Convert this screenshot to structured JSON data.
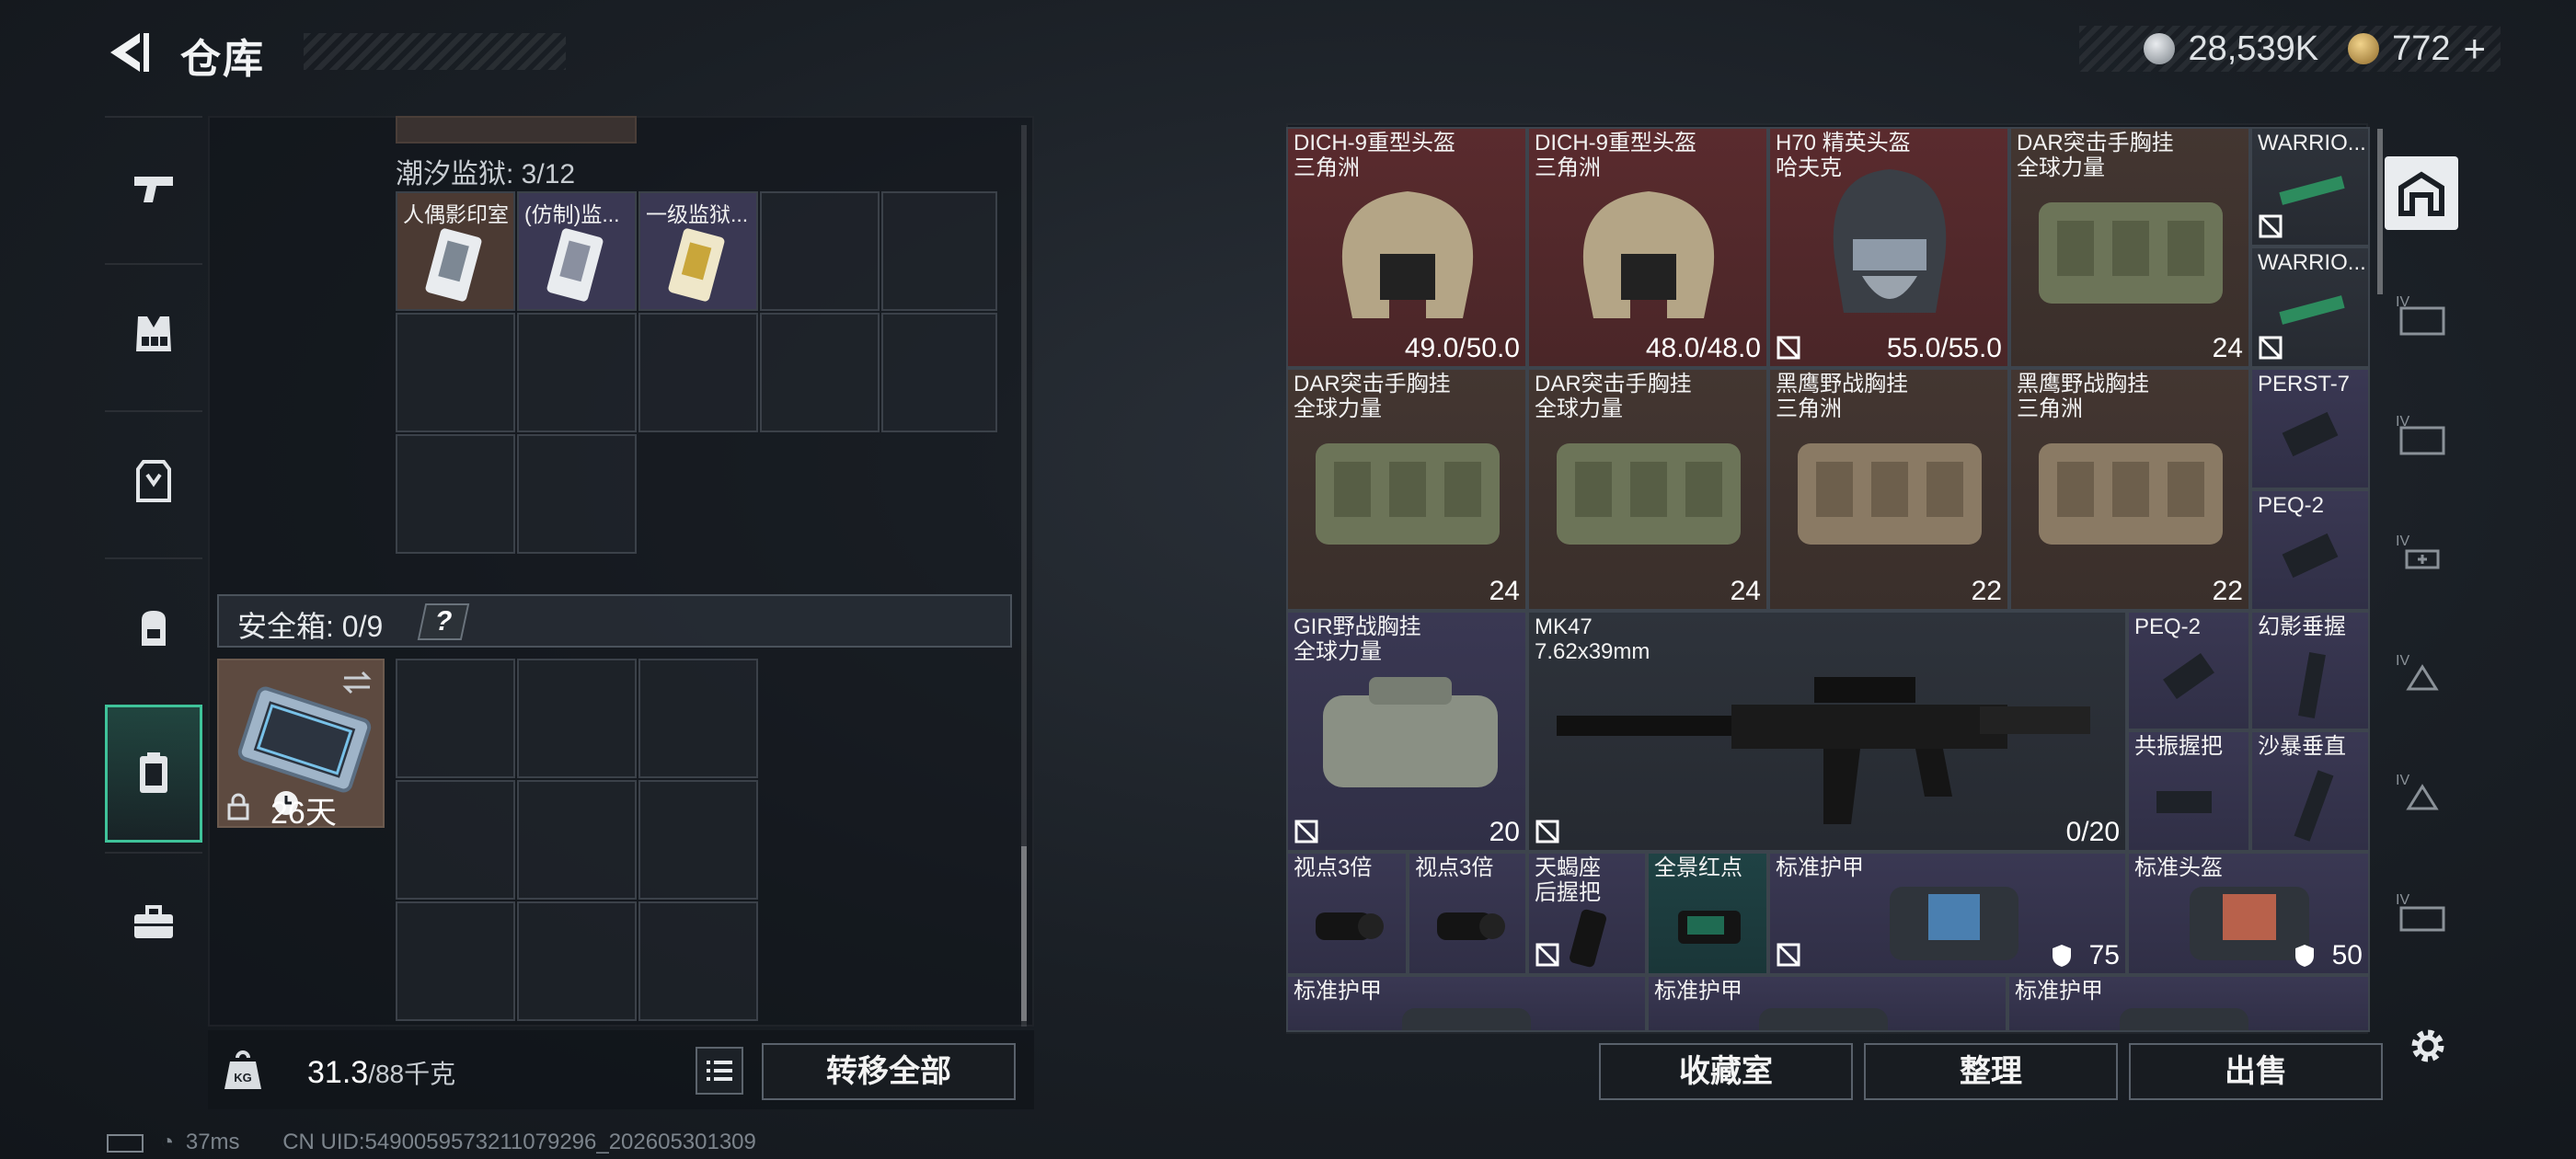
{
  "header": {
    "title": "仓库"
  },
  "currency": {
    "silver": "28,539K",
    "gold": "772",
    "gold_plus": "+"
  },
  "inventory": {
    "prison_label": "潮汐监狱: 3/12",
    "slots": [
      {
        "label": "人偶影印室"
      },
      {
        "label": "(仿制)监..."
      },
      {
        "label": "一级监狱..."
      }
    ],
    "safebox_label": "安全箱: 0/9",
    "safebox_help": "?",
    "safecase_days": "26天",
    "weight_value": "31.3",
    "weight_max": "/88千克",
    "transfer_all": "转移全部"
  },
  "stash": {
    "items": [
      {
        "name": "DICH-9重型头盔",
        "sub": "三角洲",
        "value": "49.0/50.0"
      },
      {
        "name": "DICH-9重型头盔",
        "sub": "三角洲",
        "value": "48.0/48.0"
      },
      {
        "name": "H70 精英头盔",
        "sub": "哈夫克",
        "value": "55.0/55.0"
      },
      {
        "name": "DAR突击手胸挂",
        "sub": "全球力量",
        "value": "24"
      },
      {
        "name": "WARRIO...",
        "sub": "",
        "value": ""
      },
      {
        "name": "WARRIO...",
        "sub": "",
        "value": ""
      },
      {
        "name": "DAR突击手胸挂",
        "sub": "全球力量",
        "value": "24"
      },
      {
        "name": "DAR突击手胸挂",
        "sub": "全球力量",
        "value": "24"
      },
      {
        "name": "黑鹰野战胸挂",
        "sub": "三角洲",
        "value": "22"
      },
      {
        "name": "黑鹰野战胸挂",
        "sub": "三角洲",
        "value": "22"
      },
      {
        "name": "PERST-7",
        "sub": "",
        "value": ""
      },
      {
        "name": "PEQ-2",
        "sub": "",
        "value": ""
      },
      {
        "name": "GIR野战胸挂",
        "sub": "全球力量",
        "value": "20"
      },
      {
        "name": "MK47",
        "sub": "7.62x39mm",
        "value": "0/20"
      },
      {
        "name": "PEQ-2",
        "sub": "",
        "value": ""
      },
      {
        "name": "幻影垂握",
        "sub": "",
        "value": ""
      },
      {
        "name": "共振握把",
        "sub": "",
        "value": ""
      },
      {
        "name": "沙暴垂直",
        "sub": "",
        "value": ""
      },
      {
        "name": "视点3倍",
        "sub": "",
        "value": ""
      },
      {
        "name": "视点3倍",
        "sub": "",
        "value": ""
      },
      {
        "name": "天蝎座",
        "sub": "后握把",
        "value": ""
      },
      {
        "name": "全景红点",
        "sub": "",
        "value": ""
      },
      {
        "name": "标准护甲",
        "sub": "",
        "value": "75"
      },
      {
        "name": "标准头盔",
        "sub": "",
        "value": "50"
      },
      {
        "name": "标准护甲",
        "sub": "",
        "value": ""
      },
      {
        "name": "标准护甲",
        "sub": "",
        "value": ""
      },
      {
        "name": "标准护甲",
        "sub": "",
        "value": ""
      }
    ],
    "buttons": {
      "collection": "收藏室",
      "organize": "整理",
      "sell": "出售"
    }
  },
  "status": {
    "ping": "37ms",
    "uid": "CN UID:5490059573211079296_202605301309"
  },
  "colors": {
    "accent": "#3fc39a",
    "red_slot": "#5a2b2e",
    "purple_slot": "#3a3853"
  }
}
